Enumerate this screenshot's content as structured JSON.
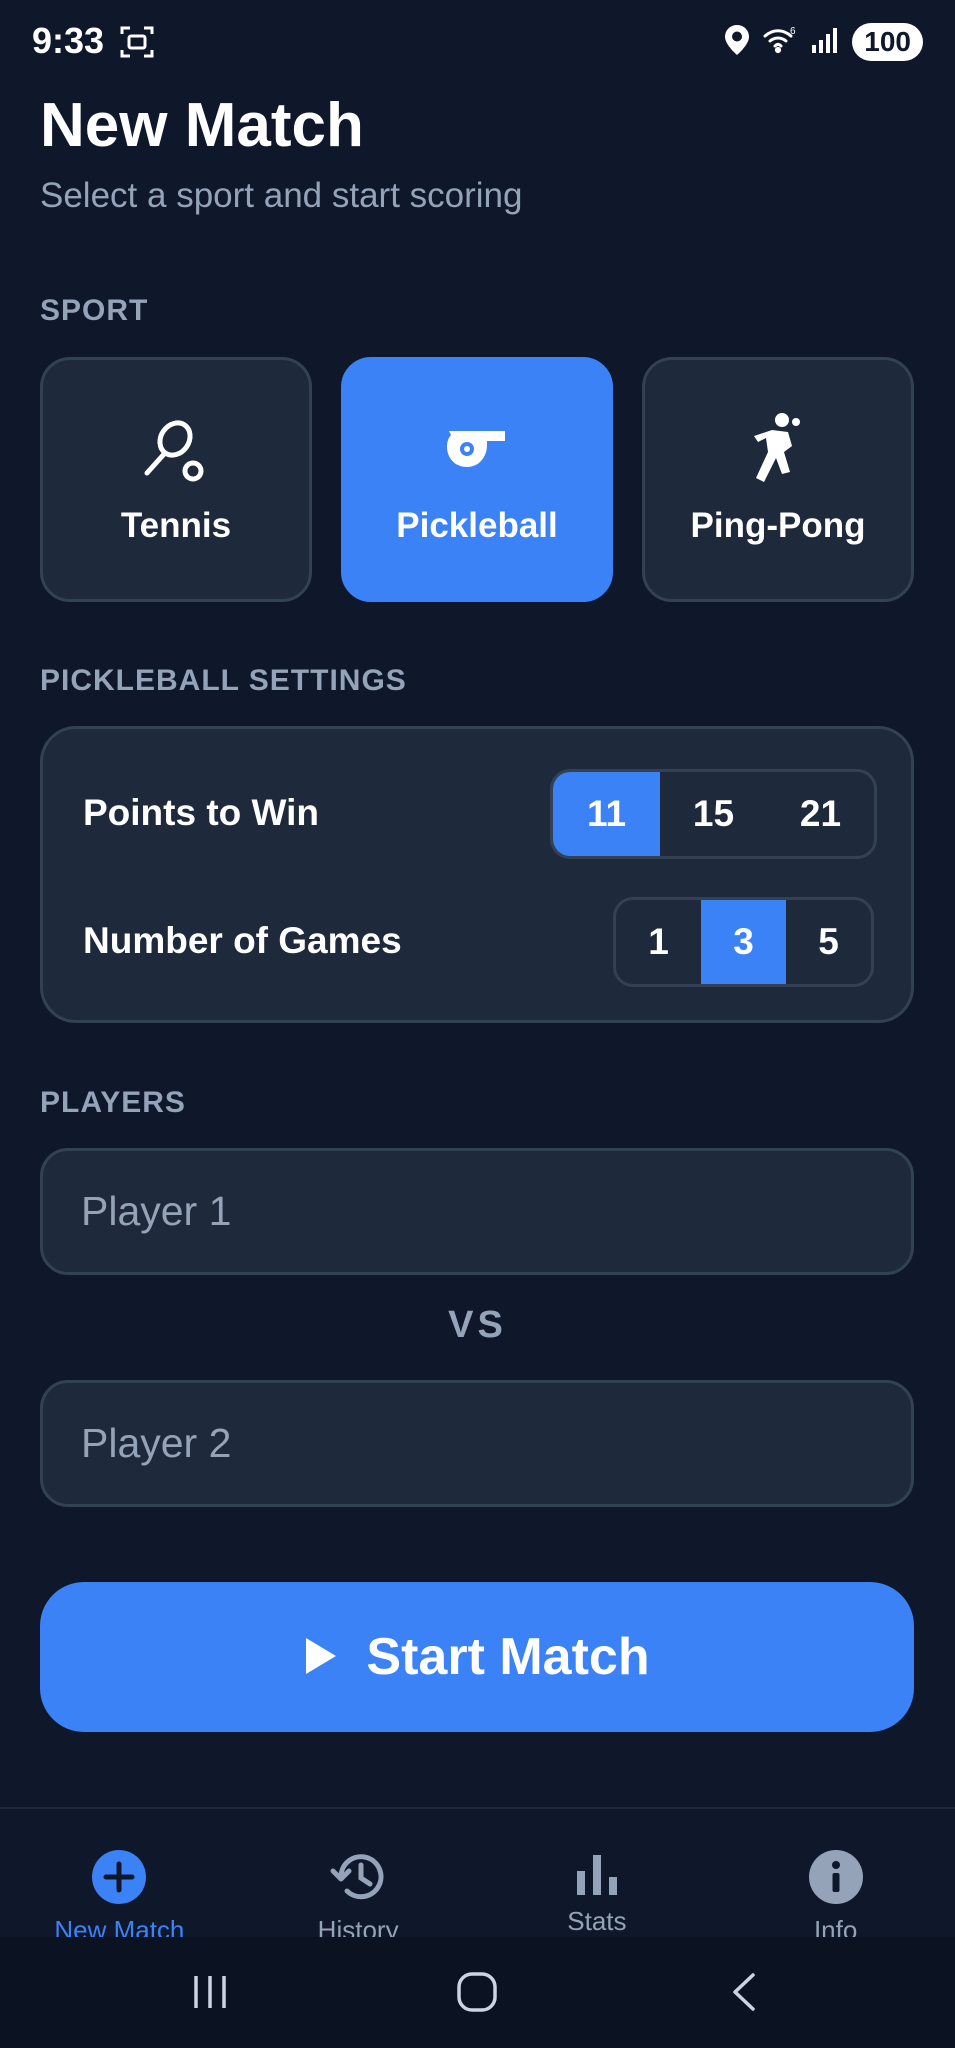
{
  "status_bar": {
    "time": "9:33",
    "battery": "100"
  },
  "header": {
    "title": "New Match",
    "subtitle": "Select a sport and start scoring"
  },
  "sport_section": {
    "label": "SPORT",
    "options": [
      {
        "name": "Tennis",
        "icon": "tennis-racket-icon",
        "selected": false
      },
      {
        "name": "Pickleball",
        "icon": "whistle-icon",
        "selected": true
      },
      {
        "name": "Ping-Pong",
        "icon": "ping-pong-player-icon",
        "selected": false
      }
    ]
  },
  "settings": {
    "label": "PICKLEBALL SETTINGS",
    "points_to_win": {
      "label": "Points to Win",
      "options": [
        "11",
        "15",
        "21"
      ],
      "selected": "11"
    },
    "number_of_games": {
      "label": "Number of Games",
      "options": [
        "1",
        "3",
        "5"
      ],
      "selected": "3"
    }
  },
  "players": {
    "label": "PLAYERS",
    "player1": {
      "placeholder": "Player 1",
      "value": ""
    },
    "vs": "VS",
    "player2": {
      "placeholder": "Player 2",
      "value": ""
    }
  },
  "start_button": {
    "label": "Start Match",
    "icon": "play-icon"
  },
  "bottom_nav": {
    "items": [
      {
        "label": "New Match",
        "icon": "plus-circle-icon",
        "active": true
      },
      {
        "label": "History",
        "icon": "history-icon",
        "active": false
      },
      {
        "label": "Stats",
        "icon": "bar-chart-icon",
        "active": false
      },
      {
        "label": "Info",
        "icon": "info-icon",
        "active": false
      }
    ]
  },
  "colors": {
    "background": "#0f172a",
    "card": "#1e293b",
    "border": "#334155",
    "accent": "#3b82f6",
    "muted": "#94a3b8"
  }
}
